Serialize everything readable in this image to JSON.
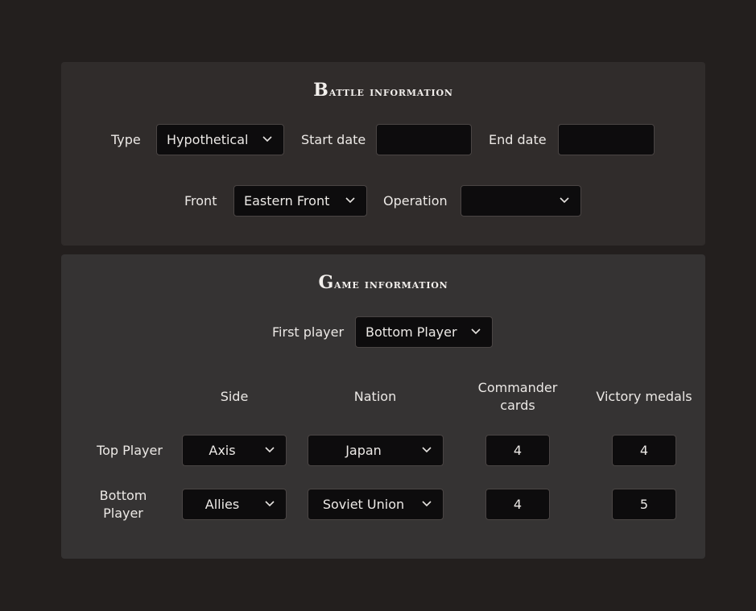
{
  "battle": {
    "title_first": "B",
    "title_rest": "attle information",
    "type_label": "Type",
    "type_value": "Hypothetical",
    "start_date_label": "Start date",
    "start_date_value": "",
    "end_date_label": "End date",
    "end_date_value": "",
    "front_label": "Front",
    "front_value": "Eastern Front",
    "operation_label": "Operation",
    "operation_value": ""
  },
  "game": {
    "title_first": "G",
    "title_rest": "ame information",
    "first_player_label": "First player",
    "first_player_value": "Bottom Player",
    "headers": {
      "side": "Side",
      "nation": "Nation",
      "commander_cards": "Commander cards",
      "victory_medals": "Victory medals"
    },
    "rows": [
      {
        "player": "Top Player",
        "side": "Axis",
        "nation": "Japan",
        "commander_cards": "4",
        "victory_medals": "4"
      },
      {
        "player": "Bottom Player",
        "side": "Allies",
        "nation": "Soviet Union",
        "commander_cards": "4",
        "victory_medals": "5"
      }
    ]
  },
  "icons": {
    "dropdown": "chevron-down-icon"
  }
}
